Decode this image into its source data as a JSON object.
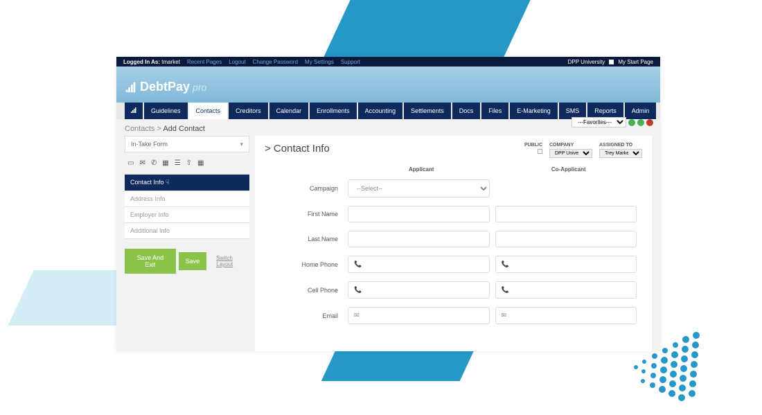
{
  "topbar": {
    "logged_in_prefix": "Logged In As:",
    "logged_in_user": "tmarket",
    "links": [
      "Recent Pages",
      "Logout",
      "Change Password",
      "My Settings",
      "Support"
    ],
    "right_university": "DPP University",
    "right_startpage": "My Start Page"
  },
  "logo": {
    "brand": "DebtPay",
    "suffix": "pro"
  },
  "nav": [
    "Guidelines",
    "Contacts",
    "Creditors",
    "Calendar",
    "Enrollments",
    "Accounting",
    "Settlements",
    "Docs",
    "Files",
    "E-Marketing",
    "SMS",
    "Reports",
    "Admin"
  ],
  "nav_active": "Contacts",
  "breadcrumb": {
    "root": "Contacts",
    "sep": ">",
    "current": "Add Contact"
  },
  "favorites": {
    "label": "---Favorites---"
  },
  "sidebar": {
    "intake": "In-Take Form",
    "sections": [
      "Contact Info",
      "Address Info",
      "Employer Info",
      "Additional Info"
    ],
    "active_section": "Contact Info",
    "save_exit": "Save And Exit",
    "save": "Save",
    "switch": "Switch Layout"
  },
  "main": {
    "title": "> Contact Info",
    "meta": {
      "public_label": "PUBLIC",
      "company_label": "COMPANY",
      "company_value": "DPP University",
      "assigned_label": "ASSIGNED TO",
      "assigned_value": "Trey Market"
    },
    "col_applicant": "Applicant",
    "col_coapplicant": "Co-Applicant",
    "fields": {
      "campaign": {
        "label": "Campaign",
        "value": "--Select--"
      },
      "first_name": {
        "label": "First Name"
      },
      "last_name": {
        "label": "Last Name"
      },
      "home_phone": {
        "label": "Home Phone"
      },
      "cell_phone": {
        "label": "Cell Phone"
      },
      "email": {
        "label": "Email"
      }
    }
  }
}
